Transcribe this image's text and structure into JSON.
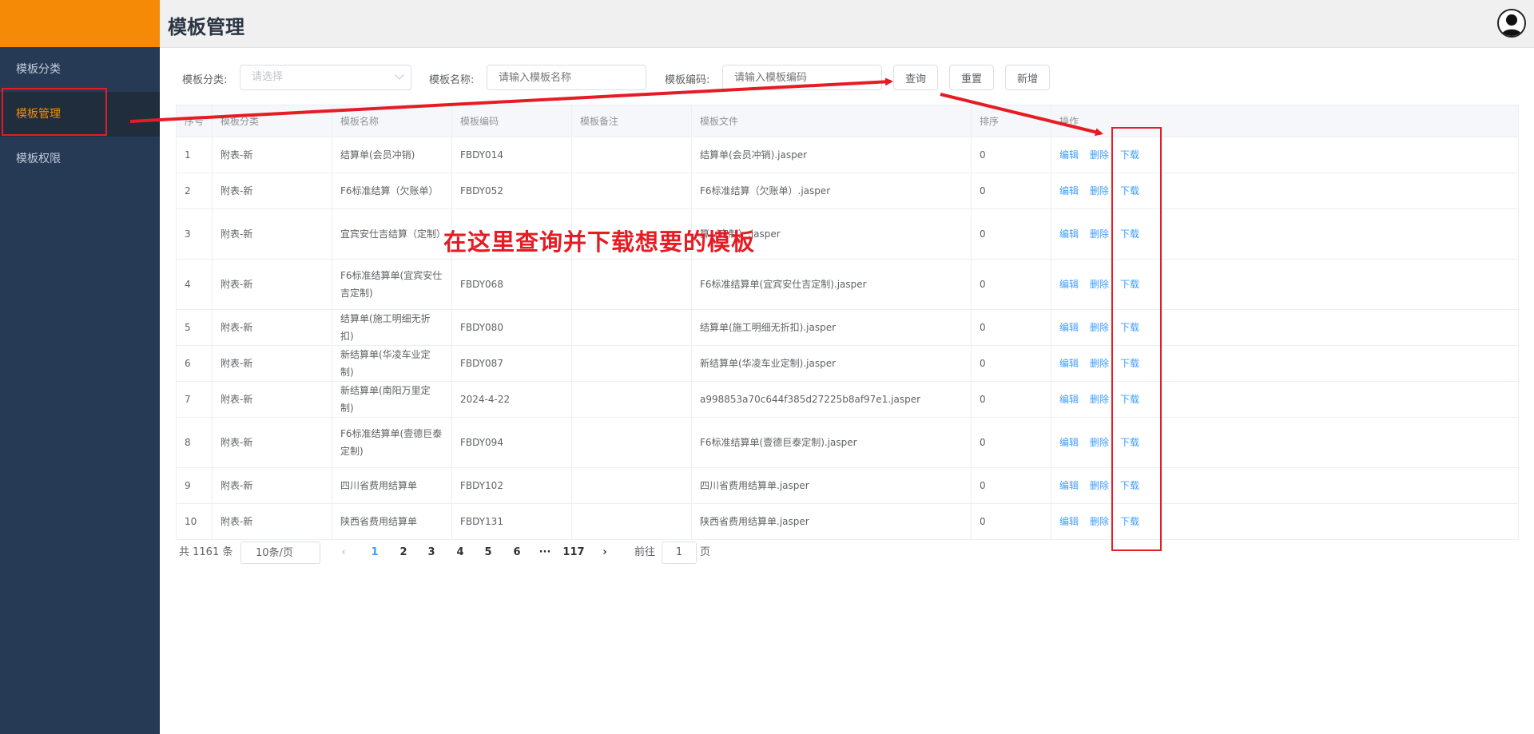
{
  "header": {
    "title": "模板管理"
  },
  "sidebar": {
    "items": [
      {
        "label": "模板分类"
      },
      {
        "label": "模板管理"
      },
      {
        "label": "模板权限"
      }
    ]
  },
  "search": {
    "category_label": "模板分类:",
    "category_placeholder": "请选择",
    "name_label": "模板名称:",
    "name_placeholder": "请输入模板名称",
    "code_label": "模板编码:",
    "code_placeholder": "请输入模板编码",
    "query_button": "查询",
    "reset_button": "重置",
    "add_button": "新增"
  },
  "table": {
    "headers": [
      "序号",
      "模板分类",
      "模板名称",
      "模板编码",
      "模板备注",
      "模板文件",
      "排序",
      "操作"
    ],
    "rows": [
      [
        "1",
        "附表-新",
        "结算单(会员冲销)",
        "FBDY014",
        "",
        "结算单(会员冲销).jasper",
        "0"
      ],
      [
        "2",
        "附表-新",
        "F6标准结算（欠账单）",
        "FBDY052",
        "",
        "F6标准结算（欠账单）.jasper",
        "0"
      ],
      [
        "3",
        "附表-新",
        "宜宾安仕吉结算（定制）",
        "",
        "",
        "算（定制）.jasper",
        "0"
      ],
      [
        "4",
        "附表-新",
        "F6标准结算单(宜宾安仕吉定制)",
        "FBDY068",
        "",
        "F6标准结算单(宜宾安仕吉定制).jasper",
        "0"
      ],
      [
        "5",
        "附表-新",
        "结算单(施工明细无折扣)",
        "FBDY080",
        "",
        "结算单(施工明细无折扣).jasper",
        "0"
      ],
      [
        "6",
        "附表-新",
        "新结算单(华凌车业定制)",
        "FBDY087",
        "",
        "新结算单(华凌车业定制).jasper",
        "0"
      ],
      [
        "7",
        "附表-新",
        "新结算单(南阳万里定制)",
        "2024-4-22",
        "",
        "a998853a70c644f385d27225b8af97e1.jasper",
        "0"
      ],
      [
        "8",
        "附表-新",
        "F6标准结算单(壹德巨泰定制)",
        "FBDY094",
        "",
        "F6标准结算单(壹德巨泰定制).jasper",
        "0"
      ],
      [
        "9",
        "附表-新",
        "四川省费用结算单",
        "FBDY102",
        "",
        "四川省费用结算单.jasper",
        "0"
      ],
      [
        "10",
        "附表-新",
        "陕西省费用结算单",
        "FBDY131",
        "",
        "陕西省费用结算单.jasper",
        "0"
      ]
    ],
    "actions": {
      "edit": "编辑",
      "delete": "删除",
      "download": "下载"
    }
  },
  "pagination": {
    "total": "共 1161 条",
    "page_size": "10条/页",
    "pages": [
      "1",
      "2",
      "3",
      "4",
      "5",
      "6",
      "···",
      "117"
    ],
    "current": "1",
    "goto_prefix": "前往",
    "goto_value": "1",
    "goto_suffix": "页"
  },
  "annotation": {
    "text": "在这里查询并下载想要的模板",
    "color": "#e51c23"
  },
  "colors": {
    "sidebar": "#273a55",
    "accent": "#f58a07",
    "link": "#409eff"
  }
}
